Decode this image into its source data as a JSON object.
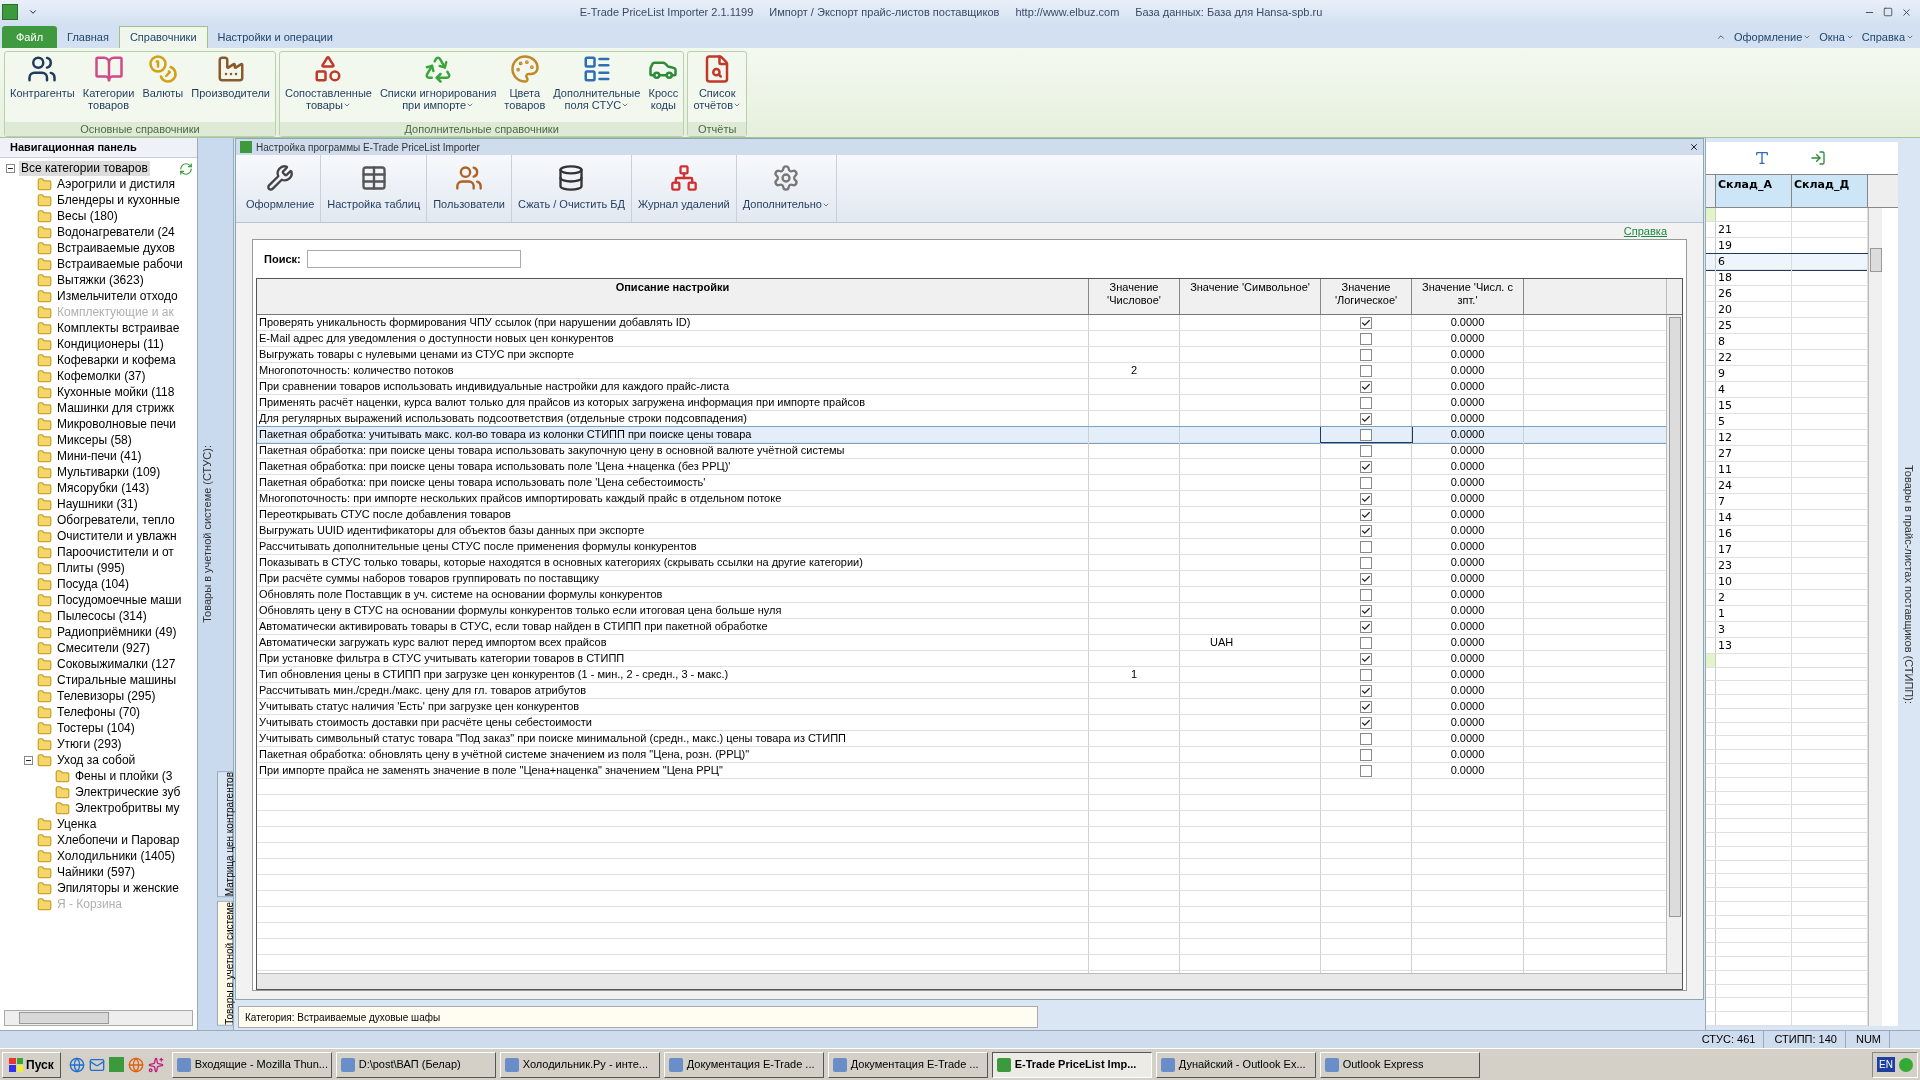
{
  "title_bar": {
    "texts": [
      "E-Trade PriceList Importer 2.1.1199",
      "Импорт / Экспорт прайс-листов поставщиков",
      "http://www.elbuz.com",
      "База данных: База для Hansa-spb.ru"
    ]
  },
  "menu_tabs": [
    {
      "label": "Файл",
      "kind": "file",
      "selected": false
    },
    {
      "label": "Главная",
      "kind": "tab",
      "selected": false
    },
    {
      "label": "Справочники",
      "kind": "tab",
      "selected": true
    },
    {
      "label": "Настройки и операции",
      "kind": "tab",
      "selected": false
    }
  ],
  "menu_right": [
    "Оформление",
    "Окна",
    "Справка"
  ],
  "ribbon": {
    "groups": [
      {
        "title": "Основные справочники",
        "buttons": [
          {
            "lines": [
              "Контрагенты"
            ],
            "dropdown": false
          },
          {
            "lines": [
              "Категории",
              "товаров"
            ],
            "dropdown": false
          },
          {
            "lines": [
              "Валюты"
            ],
            "dropdown": false
          },
          {
            "lines": [
              "Производители"
            ],
            "dropdown": false
          }
        ]
      },
      {
        "title": "Дополнительные справочники",
        "buttons": [
          {
            "lines": [
              "Сопоставленные",
              "товары"
            ],
            "dropdown": true
          },
          {
            "lines": [
              "Списки игнорирования",
              "при импорте"
            ],
            "dropdown": true
          },
          {
            "lines": [
              "Цвета",
              "товаров"
            ],
            "dropdown": false
          },
          {
            "lines": [
              "Дополнительные",
              "поля СТУС"
            ],
            "dropdown": true
          },
          {
            "lines": [
              "Кросс",
              "коды"
            ],
            "dropdown": false
          }
        ]
      },
      {
        "title": "Отчёты",
        "buttons": [
          {
            "lines": [
              "Список",
              "отчётов"
            ],
            "dropdown": true
          }
        ]
      }
    ]
  },
  "nav_panel": {
    "title": "Навигационная панель",
    "tree": [
      {
        "label": "Все категории товаров",
        "selected": true,
        "expanded": true,
        "disabled": false,
        "children": [
          {
            "label": "Аэрогрили и дистиля",
            "selected": false,
            "disabled": false
          },
          {
            "label": "Блендеры и кухонные",
            "selected": false,
            "disabled": false
          },
          {
            "label": "Весы (180)",
            "selected": false,
            "disabled": false
          },
          {
            "label": "Водонагреватели (24",
            "selected": false,
            "disabled": false
          },
          {
            "label": "Встраиваемые духов",
            "selected": false,
            "disabled": false
          },
          {
            "label": "Встраиваемые рабочи",
            "selected": false,
            "disabled": false
          },
          {
            "label": "Вытяжки (3623)",
            "selected": false,
            "disabled": false
          },
          {
            "label": "Измельчители отходо",
            "selected": false,
            "disabled": false
          },
          {
            "label": "Комплектующие и ак",
            "selected": false,
            "disabled": true
          },
          {
            "label": "Комплекты встраивае",
            "selected": false,
            "disabled": false
          },
          {
            "label": "Кондиционеры (11)",
            "selected": false,
            "disabled": false
          },
          {
            "label": "Кофеварки и кофема",
            "selected": false,
            "disabled": false
          },
          {
            "label": "Кофемолки (37)",
            "selected": false,
            "disabled": false
          },
          {
            "label": "Кухонные мойки (118",
            "selected": false,
            "disabled": false
          },
          {
            "label": "Машинки для стрижк",
            "selected": false,
            "disabled": false
          },
          {
            "label": "Микроволновые печи",
            "selected": false,
            "disabled": false
          },
          {
            "label": "Миксеры (58)",
            "selected": false,
            "disabled": false
          },
          {
            "label": "Мини-печи (41)",
            "selected": false,
            "disabled": false
          },
          {
            "label": "Мультиварки (109)",
            "selected": false,
            "disabled": false
          },
          {
            "label": "Мясорубки (143)",
            "selected": false,
            "disabled": false
          },
          {
            "label": "Наушники (31)",
            "selected": false,
            "disabled": false
          },
          {
            "label": "Обогреватели, тепло",
            "selected": false,
            "disabled": false
          },
          {
            "label": "Очистители и увлажн",
            "selected": false,
            "disabled": false
          },
          {
            "label": "Пароочистители и от",
            "selected": false,
            "disabled": false
          },
          {
            "label": "Плиты (995)",
            "selected": false,
            "disabled": false
          },
          {
            "label": "Посуда (104)",
            "selected": false,
            "disabled": false
          },
          {
            "label": "Посудомоечные маши",
            "selected": false,
            "disabled": false
          },
          {
            "label": "Пылесосы (314)",
            "selected": false,
            "disabled": false
          },
          {
            "label": "Радиоприёмники (49)",
            "selected": false,
            "disabled": false
          },
          {
            "label": "Смесители (927)",
            "selected": false,
            "disabled": false
          },
          {
            "label": "Соковыжималки (127",
            "selected": false,
            "disabled": false
          },
          {
            "label": "Стиральные машины",
            "selected": false,
            "disabled": false
          },
          {
            "label": "Телевизоры (295)",
            "selected": false,
            "disabled": false
          },
          {
            "label": "Телефоны (70)",
            "selected": false,
            "disabled": false
          },
          {
            "label": "Тостеры (104)",
            "selected": false,
            "disabled": false
          },
          {
            "label": "Утюги (293)",
            "selected": false,
            "disabled": false
          },
          {
            "label": "Уход за собой",
            "selected": false,
            "expanded": true,
            "disabled": false,
            "children": [
              {
                "label": "Фены и плойки (3",
                "selected": false,
                "disabled": false
              },
              {
                "label": "Электрические зуб",
                "selected": false,
                "disabled": false
              },
              {
                "label": "Электробритвы му",
                "selected": false,
                "disabled": false
              }
            ]
          },
          {
            "label": "Уценка",
            "selected": false,
            "disabled": false
          },
          {
            "label": "Хлебопечи и Паровар",
            "selected": false,
            "disabled": false
          },
          {
            "label": "Холодильники (1405)",
            "selected": false,
            "disabled": false
          },
          {
            "label": "Чайники (597)",
            "selected": false,
            "disabled": false
          },
          {
            "label": "Эпиляторы и женские",
            "selected": false,
            "disabled": false
          },
          {
            "label": "Я - Корзина",
            "selected": false,
            "disabled": true
          }
        ]
      }
    ]
  },
  "side_tabs": {
    "label": "Товары в учетной системе (СТУС):",
    "tabs": [
      {
        "label": "Матрица цен контрагентов",
        "selected": false
      },
      {
        "label": "Товары в учетной системе",
        "selected": true
      }
    ]
  },
  "dialog": {
    "title": "Настройка программы E-Trade PriceList Importer",
    "toolbar": [
      {
        "label": "Оформление",
        "dropdown": false
      },
      {
        "label": "Настройка таблиц",
        "dropdown": false
      },
      {
        "label": "Пользователи",
        "dropdown": false
      },
      {
        "label": "Сжать / Очистить БД",
        "dropdown": false
      },
      {
        "label": "Журнал удалений",
        "dropdown": false
      },
      {
        "label": "Дополнительно",
        "dropdown": true
      }
    ],
    "help_link": "Справка",
    "search": {
      "label": "Поиск:"
    },
    "table": {
      "columns": [
        "Описание настройки",
        "Значение 'Числовое'",
        "Значение 'Символьное'",
        "Значение 'Логическое'",
        "Значение 'Числ. с зпт.'"
      ],
      "rows": [
        {
          "description": "Проверять уникальность формирования ЧПУ ссылок (при нарушении добавлять ID)",
          "logical": true,
          "decimal": "0.0000",
          "selected": false
        },
        {
          "description": "E-Mail адрес для уведомления о доступности новых цен конкурентов",
          "logical": false,
          "decimal": "0.0000",
          "selected": false
        },
        {
          "description": "Выгружать товары с нулевыми ценами из СТУС при экспорте",
          "logical": false,
          "decimal": "0.0000",
          "selected": false
        },
        {
          "description": "Многопоточность: количество потоков",
          "numeric": "2",
          "logical": false,
          "decimal": "0.0000",
          "selected": false
        },
        {
          "description": "При сравнении товаров использовать индивидуальные настройки для каждого прайс-листа",
          "logical": true,
          "decimal": "0.0000",
          "selected": false
        },
        {
          "description": "Применять расчёт наценки, курса валют только для прайсов из которых загружена информация при импорте прайсов",
          "logical": false,
          "decimal": "0.0000",
          "selected": false
        },
        {
          "description": "Для регулярных выражений использовать подсоответствия (отдельные строки подсовпадения)",
          "logical": true,
          "decimal": "0.0000",
          "selected": false
        },
        {
          "description": "Пакетная обработка: учитывать макс. кол-во товара из колонки СТИПП при поиске цены товара",
          "logical": false,
          "decimal": "0.0000",
          "selected": true
        },
        {
          "description": "Пакетная обработка: при поиске цены товара использовать закупочную цену в основной валюте учётной системы",
          "logical": false,
          "decimal": "0.0000",
          "selected": false
        },
        {
          "description": "Пакетная обработка: при поиске цены товара использовать поле 'Цена +наценка (без РРЦ)'",
          "logical": true,
          "decimal": "0.0000",
          "selected": false
        },
        {
          "description": "Пакетная обработка: при поиске цены товара использовать поле 'Цена себестоимость'",
          "logical": false,
          "decimal": "0.0000",
          "selected": false
        },
        {
          "description": "Многопоточность: при импорте нескольких прайсов импортировать каждый прайс в отдельном потоке",
          "logical": true,
          "decimal": "0.0000",
          "selected": false
        },
        {
          "description": "Переоткрывать СТУС после добавления товаров",
          "logical": true,
          "decimal": "0.0000",
          "selected": false
        },
        {
          "description": "Выгружать UUID идентификаторы для объектов базы данных при экспорте",
          "logical": true,
          "decimal": "0.0000",
          "selected": false
        },
        {
          "description": "Рассчитывать дополнительные цены СТУС после применения формулы конкурентов",
          "logical": false,
          "decimal": "0.0000",
          "selected": false
        },
        {
          "description": "Показывать в СТУС только товары, которые находятся в основных категориях (скрывать ссылки на другие категории)",
          "logical": false,
          "decimal": "0.0000",
          "selected": false
        },
        {
          "description": "При расчёте суммы наборов товаров группировать по поставщику",
          "logical": true,
          "decimal": "0.0000",
          "selected": false
        },
        {
          "description": "Обновлять поле Поставщик в уч. системе на основании формулы конкурентов",
          "logical": false,
          "decimal": "0.0000",
          "selected": false
        },
        {
          "description": "Обновлять цену в СТУС на основании формулы конкурентов только если итоговая цена больше нуля",
          "logical": true,
          "decimal": "0.0000",
          "selected": false
        },
        {
          "description": "Автоматически активировать товары в СТУС, если товар найден в СТИПП при пакетной обработке",
          "logical": true,
          "decimal": "0.0000",
          "selected": false
        },
        {
          "description": "Автоматически загружать курс валют перед импортом всех прайсов",
          "symbolic": "UAH",
          "logical": false,
          "decimal": "0.0000",
          "selected": false
        },
        {
          "description": "При установке фильтра в СТУС учитывать категории товаров в СТИПП",
          "logical": true,
          "decimal": "0.0000",
          "selected": false
        },
        {
          "description": "Тип обновления цены в СТИПП при загрузке цен конкурентов (1 - мин., 2 - средн., 3 - макс.)",
          "numeric": "1",
          "logical": false,
          "decimal": "0.0000",
          "selected": false
        },
        {
          "description": "Рассчитывать мин./средн./макс. цену для гл. товаров атрибутов",
          "logical": true,
          "decimal": "0.0000",
          "selected": false
        },
        {
          "description": "Учитывать статус наличия 'Есть' при загрузке цен конкурентов",
          "logical": true,
          "decimal": "0.0000",
          "selected": false
        },
        {
          "description": "Учитывать стоимость доставки при расчёте цены себестоимости",
          "logical": true,
          "decimal": "0.0000",
          "selected": false
        },
        {
          "description": "Учитывать символьный статус товара \"Под заказ\" при поиске минимальной (средн., макс.) цены товара из СТИПП",
          "logical": false,
          "decimal": "0.0000",
          "selected": false
        },
        {
          "description": "Пакетная обработка: обновлять цену в учётной системе значением из поля \"Цена, розн. (РРЦ)\"",
          "logical": false,
          "decimal": "0.0000",
          "selected": false
        },
        {
          "description": "При импорте прайса не заменять значение в поле \"Цена+наценка\" значением \"Цена РРЦ\"",
          "logical": false,
          "decimal": "0.0000",
          "selected": false
        }
      ]
    }
  },
  "category_status": "Категория: Встраиваемые духовые шафы",
  "right_panel": {
    "side_label": "Товары в прайс-листах поставщиков (СТИПП):",
    "columns": [
      "Склад_А",
      "Склад_Д"
    ],
    "rows": [
      {
        "kind": "marker",
        "selected": false
      },
      {
        "kind": "data",
        "value": "21",
        "selected": false
      },
      {
        "kind": "data",
        "value": "19",
        "selected": false
      },
      {
        "kind": "data",
        "value": "6",
        "selected": true
      },
      {
        "kind": "data",
        "value": "18",
        "selected": false
      },
      {
        "kind": "data",
        "value": "26",
        "selected": false
      },
      {
        "kind": "data",
        "value": "20",
        "selected": false
      },
      {
        "kind": "data",
        "value": "25",
        "selected": false
      },
      {
        "kind": "data",
        "value": "8",
        "selected": false
      },
      {
        "kind": "data",
        "value": "22",
        "selected": false
      },
      {
        "kind": "data",
        "value": "9",
        "selected": false
      },
      {
        "kind": "data",
        "value": "4",
        "selected": false
      },
      {
        "kind": "data",
        "value": "15",
        "selected": false
      },
      {
        "kind": "data",
        "value": "5",
        "selected": false
      },
      {
        "kind": "data",
        "value": "12",
        "selected": false
      },
      {
        "kind": "data",
        "value": "27",
        "selected": false
      },
      {
        "kind": "data",
        "value": "11",
        "selected": false
      },
      {
        "kind": "data",
        "value": "24",
        "selected": false
      },
      {
        "kind": "data",
        "value": "7",
        "selected": false
      },
      {
        "kind": "data",
        "value": "14",
        "selected": false
      },
      {
        "kind": "data",
        "value": "16",
        "selected": false
      },
      {
        "kind": "data",
        "value": "17",
        "selected": false
      },
      {
        "kind": "data",
        "value": "23",
        "selected": false
      },
      {
        "kind": "data",
        "value": "10",
        "selected": false
      },
      {
        "kind": "data",
        "value": "2",
        "selected": false
      },
      {
        "kind": "data",
        "value": "1",
        "selected": false
      },
      {
        "kind": "data",
        "value": "3",
        "selected": false
      },
      {
        "kind": "data",
        "value": "13",
        "selected": false
      },
      {
        "kind": "marker",
        "selected": false
      }
    ]
  },
  "status_bar": [
    "СТУС: 461",
    "СТИПП: 140",
    "NUM"
  ],
  "taskbar": {
    "start": "Пуск",
    "tasks": [
      {
        "label": "Входящие - Mozilla Thun...",
        "selected": false
      },
      {
        "label": "D:\\post\\ВАП (Белар)",
        "selected": false
      },
      {
        "label": "Холодильник.Ру - инте...",
        "selected": false
      },
      {
        "label": "Документация E-Trade ...",
        "selected": false
      },
      {
        "label": "Документация E-Trade ...",
        "selected": false
      },
      {
        "label": "E-Trade PriceList Imp...",
        "selected": true
      },
      {
        "label": "Дунайский - Outlook Ex...",
        "selected": false
      },
      {
        "label": "Outlook Express",
        "selected": false
      }
    ],
    "language": "EN"
  }
}
